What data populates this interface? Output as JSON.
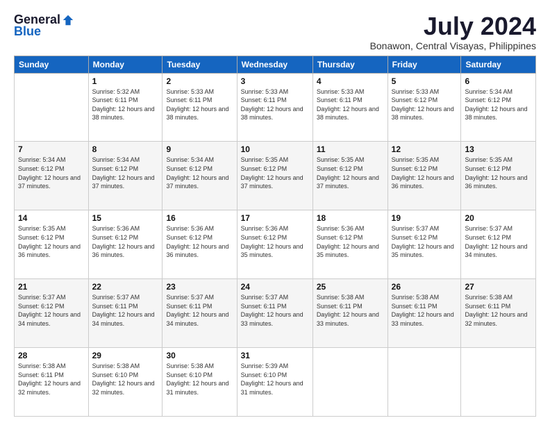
{
  "header": {
    "logo_general": "General",
    "logo_blue": "Blue",
    "month_title": "July 2024",
    "location": "Bonawon, Central Visayas, Philippines"
  },
  "days_of_week": [
    "Sunday",
    "Monday",
    "Tuesday",
    "Wednesday",
    "Thursday",
    "Friday",
    "Saturday"
  ],
  "weeks": [
    [
      {
        "day": "",
        "sunrise": "",
        "sunset": "",
        "daylight": ""
      },
      {
        "day": "1",
        "sunrise": "Sunrise: 5:32 AM",
        "sunset": "Sunset: 6:11 PM",
        "daylight": "Daylight: 12 hours and 38 minutes."
      },
      {
        "day": "2",
        "sunrise": "Sunrise: 5:33 AM",
        "sunset": "Sunset: 6:11 PM",
        "daylight": "Daylight: 12 hours and 38 minutes."
      },
      {
        "day": "3",
        "sunrise": "Sunrise: 5:33 AM",
        "sunset": "Sunset: 6:11 PM",
        "daylight": "Daylight: 12 hours and 38 minutes."
      },
      {
        "day": "4",
        "sunrise": "Sunrise: 5:33 AM",
        "sunset": "Sunset: 6:11 PM",
        "daylight": "Daylight: 12 hours and 38 minutes."
      },
      {
        "day": "5",
        "sunrise": "Sunrise: 5:33 AM",
        "sunset": "Sunset: 6:12 PM",
        "daylight": "Daylight: 12 hours and 38 minutes."
      },
      {
        "day": "6",
        "sunrise": "Sunrise: 5:34 AM",
        "sunset": "Sunset: 6:12 PM",
        "daylight": "Daylight: 12 hours and 38 minutes."
      }
    ],
    [
      {
        "day": "7",
        "sunrise": "Sunrise: 5:34 AM",
        "sunset": "Sunset: 6:12 PM",
        "daylight": "Daylight: 12 hours and 37 minutes."
      },
      {
        "day": "8",
        "sunrise": "Sunrise: 5:34 AM",
        "sunset": "Sunset: 6:12 PM",
        "daylight": "Daylight: 12 hours and 37 minutes."
      },
      {
        "day": "9",
        "sunrise": "Sunrise: 5:34 AM",
        "sunset": "Sunset: 6:12 PM",
        "daylight": "Daylight: 12 hours and 37 minutes."
      },
      {
        "day": "10",
        "sunrise": "Sunrise: 5:35 AM",
        "sunset": "Sunset: 6:12 PM",
        "daylight": "Daylight: 12 hours and 37 minutes."
      },
      {
        "day": "11",
        "sunrise": "Sunrise: 5:35 AM",
        "sunset": "Sunset: 6:12 PM",
        "daylight": "Daylight: 12 hours and 37 minutes."
      },
      {
        "day": "12",
        "sunrise": "Sunrise: 5:35 AM",
        "sunset": "Sunset: 6:12 PM",
        "daylight": "Daylight: 12 hours and 36 minutes."
      },
      {
        "day": "13",
        "sunrise": "Sunrise: 5:35 AM",
        "sunset": "Sunset: 6:12 PM",
        "daylight": "Daylight: 12 hours and 36 minutes."
      }
    ],
    [
      {
        "day": "14",
        "sunrise": "Sunrise: 5:35 AM",
        "sunset": "Sunset: 6:12 PM",
        "daylight": "Daylight: 12 hours and 36 minutes."
      },
      {
        "day": "15",
        "sunrise": "Sunrise: 5:36 AM",
        "sunset": "Sunset: 6:12 PM",
        "daylight": "Daylight: 12 hours and 36 minutes."
      },
      {
        "day": "16",
        "sunrise": "Sunrise: 5:36 AM",
        "sunset": "Sunset: 6:12 PM",
        "daylight": "Daylight: 12 hours and 36 minutes."
      },
      {
        "day": "17",
        "sunrise": "Sunrise: 5:36 AM",
        "sunset": "Sunset: 6:12 PM",
        "daylight": "Daylight: 12 hours and 35 minutes."
      },
      {
        "day": "18",
        "sunrise": "Sunrise: 5:36 AM",
        "sunset": "Sunset: 6:12 PM",
        "daylight": "Daylight: 12 hours and 35 minutes."
      },
      {
        "day": "19",
        "sunrise": "Sunrise: 5:37 AM",
        "sunset": "Sunset: 6:12 PM",
        "daylight": "Daylight: 12 hours and 35 minutes."
      },
      {
        "day": "20",
        "sunrise": "Sunrise: 5:37 AM",
        "sunset": "Sunset: 6:12 PM",
        "daylight": "Daylight: 12 hours and 34 minutes."
      }
    ],
    [
      {
        "day": "21",
        "sunrise": "Sunrise: 5:37 AM",
        "sunset": "Sunset: 6:12 PM",
        "daylight": "Daylight: 12 hours and 34 minutes."
      },
      {
        "day": "22",
        "sunrise": "Sunrise: 5:37 AM",
        "sunset": "Sunset: 6:11 PM",
        "daylight": "Daylight: 12 hours and 34 minutes."
      },
      {
        "day": "23",
        "sunrise": "Sunrise: 5:37 AM",
        "sunset": "Sunset: 6:11 PM",
        "daylight": "Daylight: 12 hours and 34 minutes."
      },
      {
        "day": "24",
        "sunrise": "Sunrise: 5:37 AM",
        "sunset": "Sunset: 6:11 PM",
        "daylight": "Daylight: 12 hours and 33 minutes."
      },
      {
        "day": "25",
        "sunrise": "Sunrise: 5:38 AM",
        "sunset": "Sunset: 6:11 PM",
        "daylight": "Daylight: 12 hours and 33 minutes."
      },
      {
        "day": "26",
        "sunrise": "Sunrise: 5:38 AM",
        "sunset": "Sunset: 6:11 PM",
        "daylight": "Daylight: 12 hours and 33 minutes."
      },
      {
        "day": "27",
        "sunrise": "Sunrise: 5:38 AM",
        "sunset": "Sunset: 6:11 PM",
        "daylight": "Daylight: 12 hours and 32 minutes."
      }
    ],
    [
      {
        "day": "28",
        "sunrise": "Sunrise: 5:38 AM",
        "sunset": "Sunset: 6:11 PM",
        "daylight": "Daylight: 12 hours and 32 minutes."
      },
      {
        "day": "29",
        "sunrise": "Sunrise: 5:38 AM",
        "sunset": "Sunset: 6:10 PM",
        "daylight": "Daylight: 12 hours and 32 minutes."
      },
      {
        "day": "30",
        "sunrise": "Sunrise: 5:38 AM",
        "sunset": "Sunset: 6:10 PM",
        "daylight": "Daylight: 12 hours and 31 minutes."
      },
      {
        "day": "31",
        "sunrise": "Sunrise: 5:39 AM",
        "sunset": "Sunset: 6:10 PM",
        "daylight": "Daylight: 12 hours and 31 minutes."
      },
      {
        "day": "",
        "sunrise": "",
        "sunset": "",
        "daylight": ""
      },
      {
        "day": "",
        "sunrise": "",
        "sunset": "",
        "daylight": ""
      },
      {
        "day": "",
        "sunrise": "",
        "sunset": "",
        "daylight": ""
      }
    ]
  ]
}
